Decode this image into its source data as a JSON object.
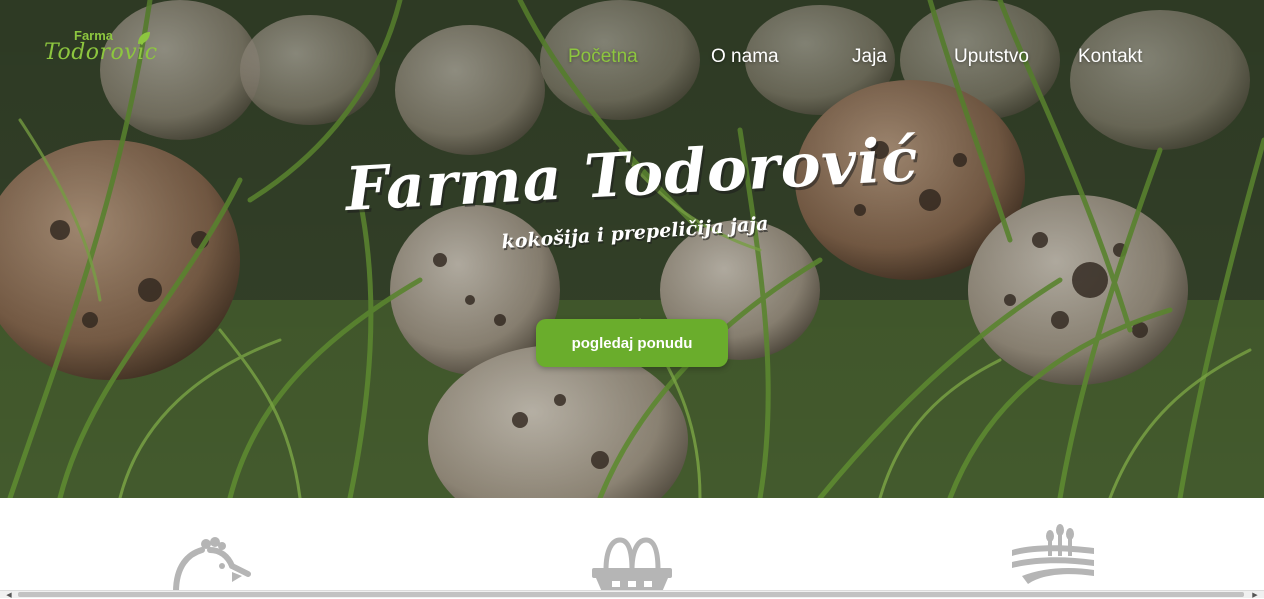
{
  "logo": {
    "top_text": "Farma",
    "main_text": "Todorovic"
  },
  "nav": {
    "items": [
      {
        "label": "Početna",
        "active": true
      },
      {
        "label": "O nama",
        "active": false
      },
      {
        "label": "Jaja",
        "active": false
      },
      {
        "label": "Uputstvo",
        "active": false
      },
      {
        "label": "Kontakt",
        "active": false
      }
    ]
  },
  "hero": {
    "title": "Farma Todorović",
    "subtitle": "kokošija i prepeličija jaja",
    "cta_label": "pogledaj ponudu"
  },
  "features": {
    "icons": [
      "chicken-icon",
      "egg-basket-icon",
      "farm-field-icon"
    ]
  },
  "colors": {
    "accent": "#8dc63f",
    "button": "#6aad2c",
    "icon_gray": "#b5b5b5"
  }
}
